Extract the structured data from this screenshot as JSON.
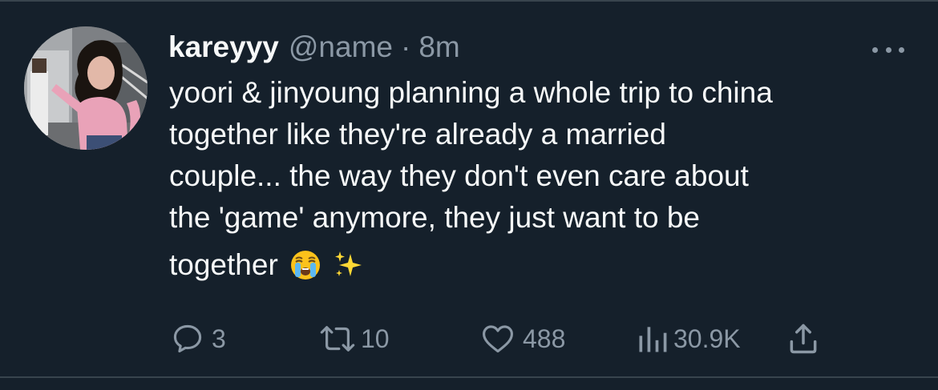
{
  "tweet": {
    "display_name": "kareyyy",
    "handle": "@name",
    "separator": "·",
    "time": "8m",
    "text_lines": [
      "yoori & jinyoung planning a whole trip to china",
      "together like they're already a married",
      "couple... the way they don't even care about",
      "the 'game' anymore, they just want to be"
    ],
    "last_line": "together",
    "emojis": [
      "loudly-crying-face",
      "sparkles"
    ]
  },
  "actions": {
    "replies": "3",
    "retweets": "10",
    "likes": "488",
    "views": "30.9K"
  },
  "icons": {
    "reply": "speech-bubble-icon",
    "retweet": "retweet-arrows-icon",
    "like": "heart-icon",
    "views": "bar-chart-icon",
    "share": "share-upload-icon",
    "more": "more-dots-icon"
  },
  "colors": {
    "background": "#15202b",
    "text_primary": "#f7f9f9",
    "text_secondary": "#8b98a5",
    "divider": "#38444d"
  }
}
